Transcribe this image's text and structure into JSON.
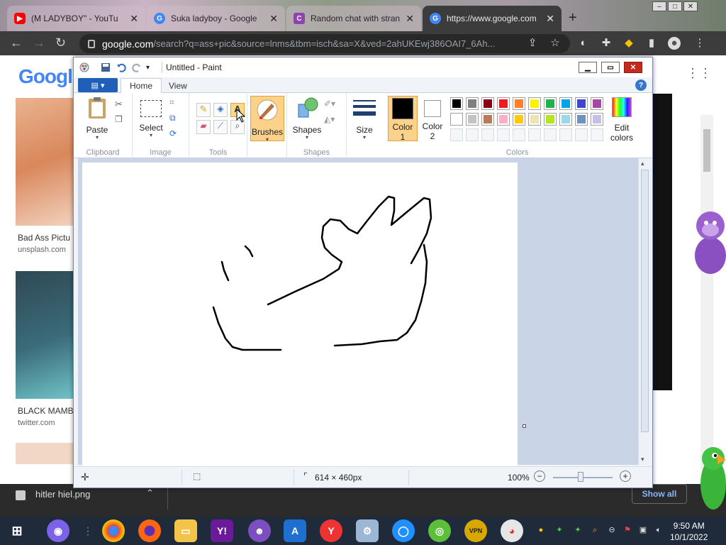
{
  "chrome": {
    "tabs": [
      {
        "label": "(M LADYBOY\" - YouTu",
        "icon": "youtube-icon",
        "color": "#ff0000"
      },
      {
        "label": "Suka ladyboy - Google",
        "icon": "google-icon",
        "color": "#4285f4"
      },
      {
        "label": "Random chat with stran",
        "icon": "chat-site-icon",
        "color": "#8e44ad"
      },
      {
        "label": "https://www.google.com",
        "icon": "google-icon",
        "color": "#4285f4",
        "active": true
      }
    ],
    "url_host": "google.com",
    "url_rest": "/search?q=ass+pic&source=lnms&tbm=isch&sa=X&ved=2ahUKEwj386OAI7_6Ah..."
  },
  "google": {
    "logo": "Google",
    "results": [
      {
        "caption": "Bad Ass Pictu",
        "source": "unsplash.com"
      },
      {
        "caption": "BLACK MAMB",
        "source": "twitter.com"
      }
    ]
  },
  "downloads": {
    "filename": "hitler hiel.png",
    "show_all": "Show all"
  },
  "paint": {
    "title": "Untitled - Paint",
    "tabs": {
      "home": "Home",
      "view": "View"
    },
    "groups": {
      "clipboard": "Clipboard",
      "image": "Image",
      "tools": "Tools",
      "shapes": "Shapes",
      "colors": "Colors"
    },
    "buttons": {
      "paste": "Paste",
      "select": "Select",
      "brushes": "Brushes",
      "shapes": "Shapes",
      "size": "Size",
      "color1_a": "Color",
      "color1_b": "1",
      "color2_a": "Color",
      "color2_b": "2",
      "edit_a": "Edit",
      "edit_b": "colors"
    },
    "palette_row1": [
      "#000000",
      "#7f7f7f",
      "#880015",
      "#ed1c24",
      "#ff7f27",
      "#fff200",
      "#22b14c",
      "#00a2e8",
      "#3f48cc",
      "#a349a4"
    ],
    "palette_row2": [
      "#ffffff",
      "#c3c3c3",
      "#b97a57",
      "#ffaec9",
      "#ffc90e",
      "#efe4b0",
      "#b5e61d",
      "#99d9ea",
      "#7092be",
      "#c8bfe7"
    ],
    "color1": "#000000",
    "color2": "#ffffff",
    "status": {
      "dimensions": "614 × 460px",
      "zoom": "100%"
    }
  },
  "taskbar": {
    "time": "9:50 AM",
    "date": "10/1/2022"
  }
}
